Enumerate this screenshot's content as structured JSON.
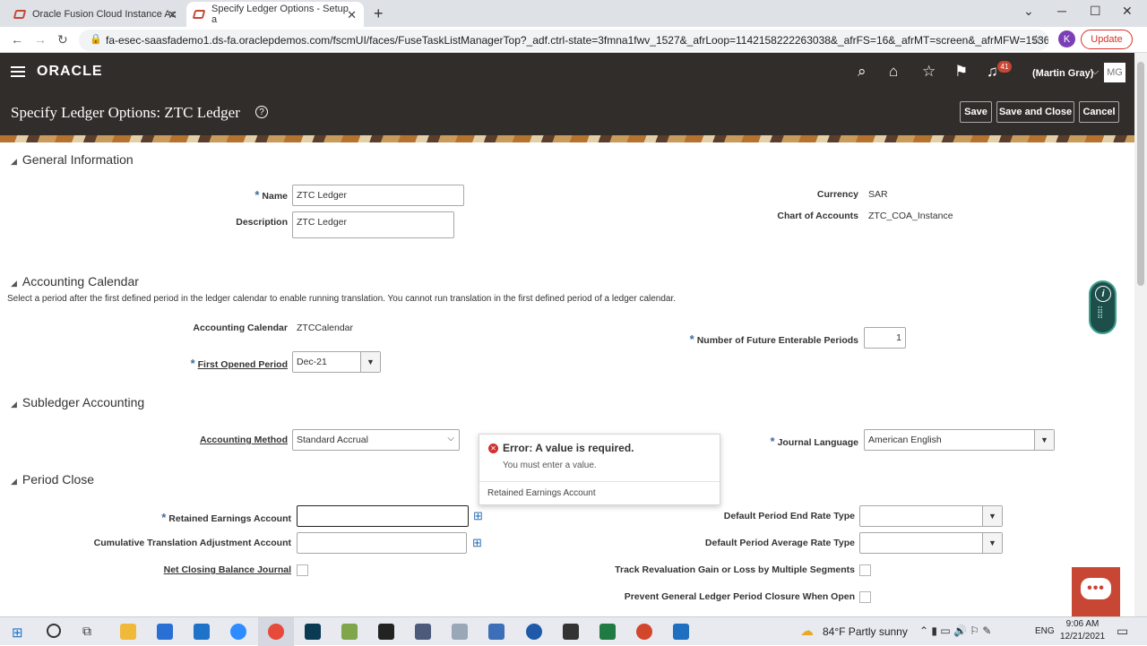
{
  "browser": {
    "tabs": [
      {
        "title": "Oracle Fusion Cloud Instance Ac"
      },
      {
        "title": "Specify Ledger Options - Setup a"
      }
    ],
    "new_tab": "+",
    "url": "fa-esec-saasfademo1.ds-fa.oraclepdemos.com/fscmUI/faces/FuseTaskListManagerTop?_adf.ctrl-state=3fmna1fwv_1527&_afrLoop=1142158222263038&_afrFS=16&_afrMT=screen&_afrMFW=1536...",
    "profile_initial": "K",
    "update_label": "Update"
  },
  "header": {
    "brand": "ORACLE",
    "notification_count": "41",
    "user_name": "(Martin Gray)",
    "user_initials": "MG",
    "page_title": "Specify Ledger Options: ZTC Ledger",
    "save_label": "Save",
    "save_close_label": "Save and Close",
    "cancel_label": "Cancel"
  },
  "general": {
    "title": "General Information",
    "name_label": "Name",
    "name_value": "ZTC Ledger",
    "description_label": "Description",
    "description_value": "ZTC Ledger",
    "currency_label": "Currency",
    "currency_value": "SAR",
    "coa_label": "Chart of Accounts",
    "coa_value": "ZTC_COA_Instance"
  },
  "calendar": {
    "title": "Accounting Calendar",
    "note": "Select a period after the first defined period in the ledger calendar to enable running translation. You cannot run translation in the first defined period of a ledger calendar.",
    "calendar_label": "Accounting Calendar",
    "calendar_value": "ZTCCalendar",
    "future_label": "Number of Future Enterable Periods",
    "future_value": "1",
    "first_label": "First Opened Period",
    "first_value": "Dec-21"
  },
  "subledger": {
    "title": "Subledger Accounting",
    "method_label": "Accounting Method",
    "method_value": "Standard Accrual",
    "language_label": "Journal Language",
    "language_value": "American English"
  },
  "error": {
    "title": "Error: A value is required.",
    "message": "You must enter a value.",
    "field": "Retained Earnings Account"
  },
  "period_close": {
    "title": "Period Close",
    "retained_label": "Retained Earnings Account",
    "cta_label": "Cumulative Translation Adjustment Account",
    "net_closing_label": "Net Closing Balance Journal",
    "end_rate_label": "Default Period End Rate Type",
    "avg_rate_label": "Default Period Average Rate Type",
    "track_label": "Track Revaluation Gain or Loss by Multiple Segments",
    "prevent_label": "Prevent General Ledger Period Closure When Open"
  },
  "taskbar": {
    "weather": "84°F  Partly sunny",
    "language": "ENG",
    "time": "9:06 AM",
    "date": "12/21/2021"
  }
}
